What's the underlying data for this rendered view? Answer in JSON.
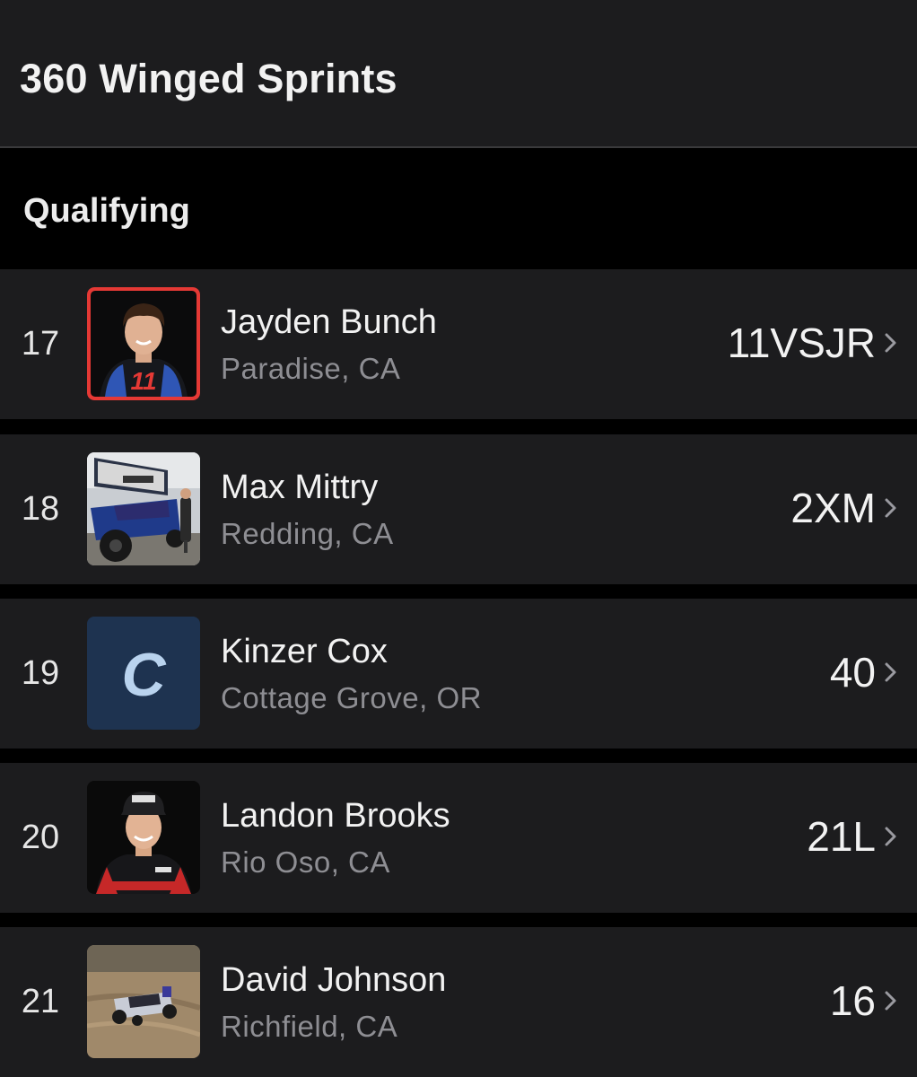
{
  "header": {
    "title": "360 Winged Sprints"
  },
  "section": {
    "title": "Qualifying"
  },
  "entries": [
    {
      "position": "17",
      "name": "Jayden Bunch",
      "location": "Paradise, CA",
      "car_number": "11VSJR",
      "thumb": "driver-photo-red-frame"
    },
    {
      "position": "18",
      "name": "Max Mittry",
      "location": "Redding, CA",
      "car_number": "2XM",
      "thumb": "sprint-car-photo"
    },
    {
      "position": "19",
      "name": "Kinzer Cox",
      "location": "Cottage Grove, OR",
      "car_number": "40",
      "thumb": "letter-c-placeholder",
      "thumb_letter": "C"
    },
    {
      "position": "20",
      "name": "Landon Brooks",
      "location": "Rio Oso, CA",
      "car_number": "21L",
      "thumb": "driver-photo"
    },
    {
      "position": "21",
      "name": "David Johnson",
      "location": "Richfield, CA",
      "car_number": "16",
      "thumb": "dirt-track-car-photo"
    }
  ],
  "colors": {
    "row_bg": "#1c1c1e",
    "secondary_text": "#8e8e93",
    "accent_red": "#e53935",
    "placeholder_bg": "#1e3350",
    "placeholder_letter": "#b9d3ee"
  }
}
